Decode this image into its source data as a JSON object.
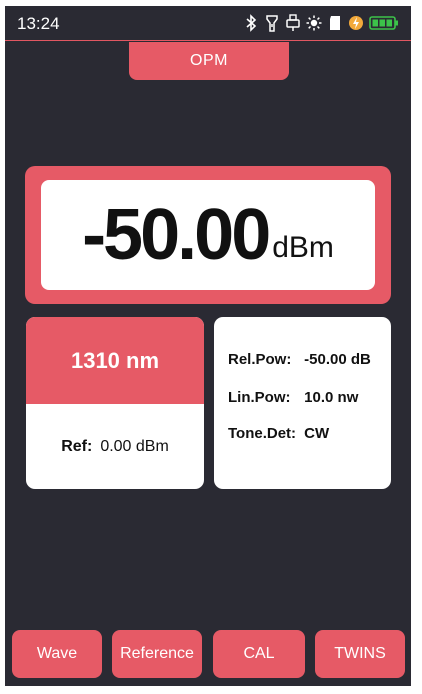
{
  "status_bar": {
    "time": "13:24",
    "icons": [
      "bluetooth-icon",
      "flashlight-icon",
      "usb-icon",
      "sun-icon",
      "sd-card-icon",
      "charging-icon",
      "battery-icon"
    ],
    "accent_color": "#e65a66",
    "battery_color": "#3cc34a"
  },
  "tab": {
    "label": "OPM"
  },
  "reading": {
    "value": "-50.00",
    "unit": "dBm"
  },
  "wavelength": {
    "label": "1310 nm",
    "ref_label": "Ref:",
    "ref_value": "0.00 dBm"
  },
  "info": {
    "rows": [
      {
        "key": "Rel.Pow:",
        "value": "-50.00 dB"
      },
      {
        "key": "Lin.Pow:",
        "value": "10.0 nw"
      },
      {
        "key": "Tone.Det:",
        "value": "CW"
      }
    ]
  },
  "buttons": {
    "wave": "Wave",
    "reference": "Reference",
    "cal": "CAL",
    "twins": "TWINS"
  }
}
